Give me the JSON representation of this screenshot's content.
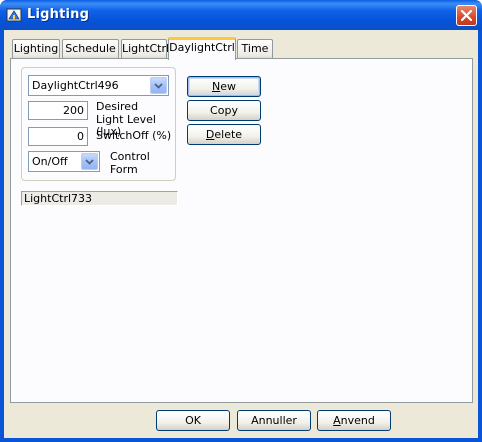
{
  "window": {
    "title": "Lighting"
  },
  "tabs": [
    {
      "label": "Lighting"
    },
    {
      "label": "Schedule"
    },
    {
      "label": "LightCtrl"
    },
    {
      "label": "DaylightCtrl"
    },
    {
      "label": "Time"
    }
  ],
  "daylight": {
    "selected_controller": "DaylightCtrl496",
    "desired_light_level": {
      "value": "200",
      "label_line1": "Desired",
      "label_line2": "Light Level (lux)"
    },
    "switch_off": {
      "value": "0",
      "label": "SwitchOff (%)"
    },
    "control_form": {
      "value": "On/Off",
      "label_line1": "Control",
      "label_line2": "Form"
    },
    "linked_light_ctrl": "LightCtrl733"
  },
  "side_buttons": {
    "new": {
      "first": "N",
      "rest": "ew"
    },
    "copy": {
      "label": "Copy"
    },
    "delete": {
      "first": "D",
      "rest": "elete"
    }
  },
  "footer": {
    "ok": "OK",
    "cancel": "Annuller",
    "apply": {
      "first": "A",
      "rest": "nvend"
    }
  },
  "colors": {
    "accent": "#0a54d8",
    "tab_highlight": "#ffc83c",
    "close": "#d7482a"
  }
}
